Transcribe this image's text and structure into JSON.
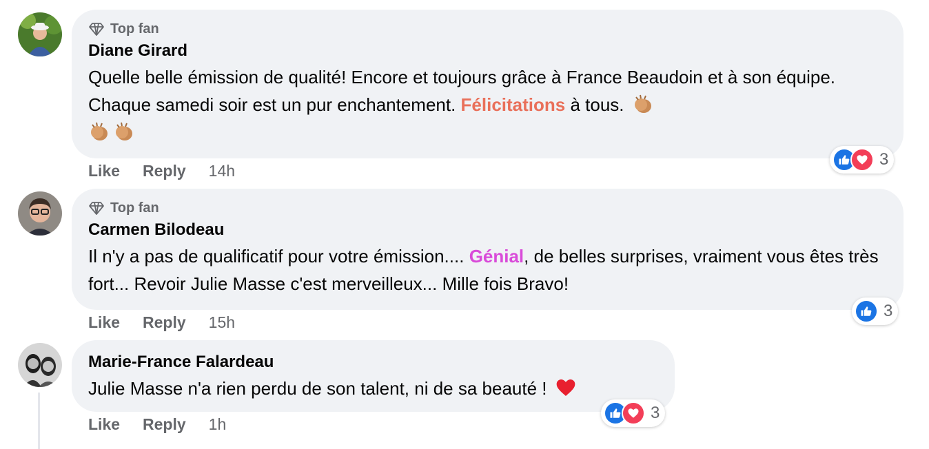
{
  "comments": [
    {
      "badge": "Top fan",
      "author": "Diane Girard",
      "text_before": "Quelle belle émission de qualité! Encore et toujours grâce à France Beaudoin et à son équipe. Chaque samedi soir est un pur enchantement. ",
      "highlight": "Félicitations",
      "text_after": " à tous.",
      "actions": {
        "like": "Like",
        "reply": "Reply",
        "time": "14h"
      },
      "reactions": {
        "types": [
          "like-icon",
          "love-icon"
        ],
        "count": "3"
      }
    },
    {
      "badge": "Top fan",
      "author": "Carmen Bilodeau",
      "text_before": "Il n'y a pas de qualificatif pour votre émission.... ",
      "highlight": "Génial",
      "text_after": ", de belles surprises, vraiment vous êtes très fort... Revoir Julie Masse c'est merveilleux... Mille fois Bravo!",
      "actions": {
        "like": "Like",
        "reply": "Reply",
        "time": "15h"
      },
      "reactions": {
        "types": [
          "like-icon"
        ],
        "count": "3"
      }
    },
    {
      "author": "Marie-France Falardeau",
      "text_before": "Julie Masse n'a rien perdu de son talent, ni de sa beauté !",
      "actions": {
        "like": "Like",
        "reply": "Reply",
        "time": "1h"
      },
      "reactions": {
        "types": [
          "like-icon",
          "love-icon"
        ],
        "count": "3"
      }
    }
  ],
  "colors": {
    "bubble": "#f0f2f5",
    "highlight_1": "#e9705a",
    "highlight_2": "#d94bd9",
    "like_blue": "#1b74e4",
    "love_red": "#f33e58"
  }
}
